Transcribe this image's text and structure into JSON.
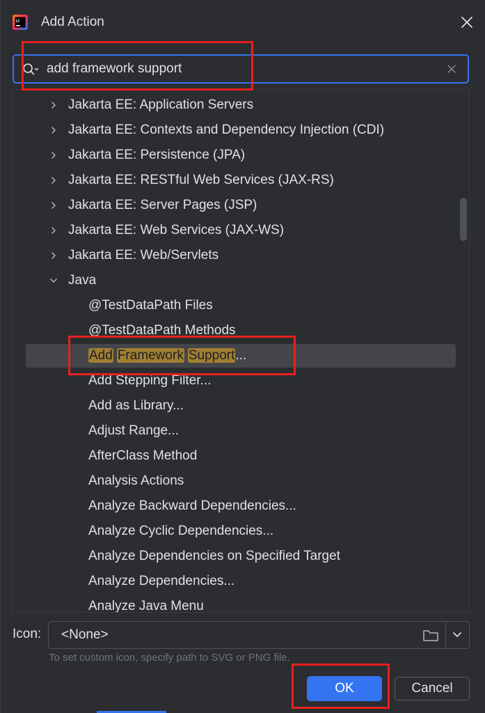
{
  "window": {
    "title": "Add Action",
    "app_icon": "intellij-idea-icon",
    "close_icon": "close-icon"
  },
  "search": {
    "value": "add framework support",
    "icon": "search-icon",
    "clear_icon": "clear-icon"
  },
  "tree": {
    "items": [
      {
        "label": "Jakarta EE: Application Servers",
        "expandable": true,
        "expanded": false
      },
      {
        "label": "Jakarta EE: Contexts and Dependency Injection (CDI)",
        "expandable": true,
        "expanded": false
      },
      {
        "label": "Jakarta EE: Persistence (JPA)",
        "expandable": true,
        "expanded": false
      },
      {
        "label": "Jakarta EE: RESTful Web Services (JAX-RS)",
        "expandable": true,
        "expanded": false
      },
      {
        "label": "Jakarta EE: Server Pages (JSP)",
        "expandable": true,
        "expanded": false
      },
      {
        "label": "Jakarta EE: Web Services (JAX-WS)",
        "expandable": true,
        "expanded": false
      },
      {
        "label": "Jakarta EE: Web/Servlets",
        "expandable": true,
        "expanded": false
      },
      {
        "label": "Java",
        "expandable": true,
        "expanded": true
      },
      {
        "label": "@TestDataPath Files",
        "expandable": false
      },
      {
        "label": "@TestDataPath Methods",
        "expandable": false
      },
      {
        "label": "Add Framework Support...",
        "expandable": false,
        "selected": true,
        "match_parts": [
          "Add",
          "Framework",
          "Support"
        ],
        "suffix": "..."
      },
      {
        "label": "Add Stepping Filter...",
        "expandable": false
      },
      {
        "label": "Add as Library...",
        "expandable": false
      },
      {
        "label": "Adjust Range...",
        "expandable": false
      },
      {
        "label": "AfterClass Method",
        "expandable": false
      },
      {
        "label": "Analysis Actions",
        "expandable": false
      },
      {
        "label": "Analyze Backward Dependencies...",
        "expandable": false
      },
      {
        "label": "Analyze Cyclic Dependencies...",
        "expandable": false
      },
      {
        "label": "Analyze Dependencies on Specified Target",
        "expandable": false
      },
      {
        "label": "Analyze Dependencies...",
        "expandable": false
      },
      {
        "label": "Analyze Java Menu",
        "expandable": false
      }
    ],
    "highlight_color": "#a17f32"
  },
  "icon_field": {
    "label": "Icon:",
    "value": "<None>",
    "hint": "To set custom icon, specify path to SVG or PNG file.",
    "browse_icon": "folder-icon",
    "dropdown_icon": "chevron-down-icon"
  },
  "buttons": {
    "ok": "OK",
    "cancel": "Cancel"
  },
  "colors": {
    "background": "#2b2d30",
    "accent": "#3574f0",
    "annotation": "#e8201c",
    "selection": "#43454a"
  }
}
